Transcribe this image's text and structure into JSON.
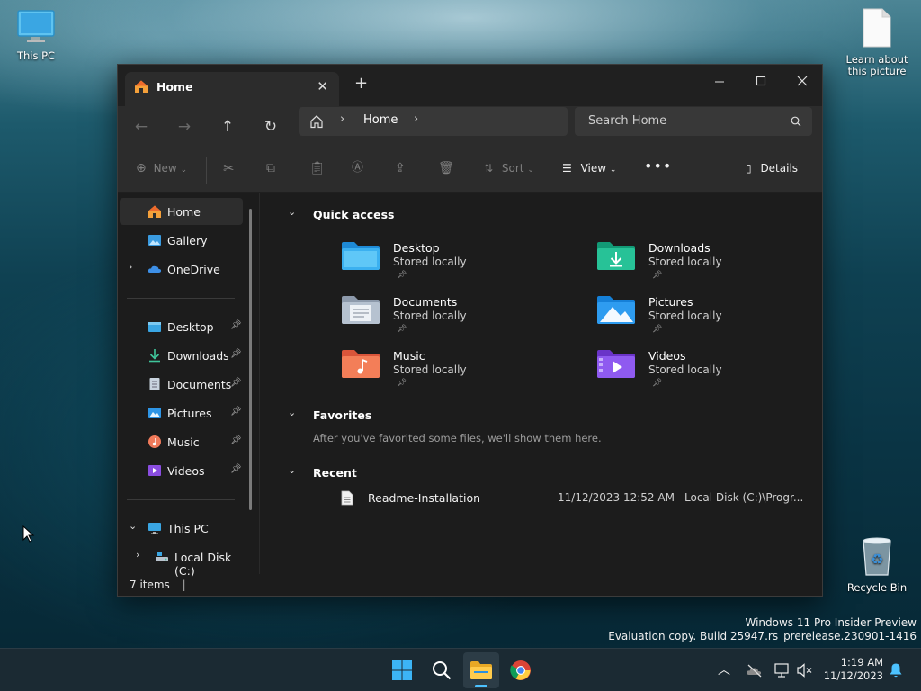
{
  "desktop": {
    "this_pc_label": "This PC",
    "learn_label": "Learn about this picture",
    "recycle_label": "Recycle Bin",
    "watermark_line1": "Windows 11 Pro Insider Preview",
    "watermark_line2": "Evaluation copy. Build 25947.rs_prerelease.230901-1416"
  },
  "window": {
    "tab_title": "Home",
    "breadcrumb": "Home",
    "search_placeholder": "Search Home",
    "toolbar": {
      "new_label": "New",
      "sort_label": "Sort",
      "view_label": "View",
      "details_label": "Details"
    },
    "sidebar": {
      "home": "Home",
      "gallery": "Gallery",
      "onedrive": "OneDrive",
      "pinned": [
        "Desktop",
        "Downloads",
        "Documents",
        "Pictures",
        "Music",
        "Videos"
      ],
      "this_pc": "This PC",
      "local_disk": "Local Disk (C:)"
    },
    "sections": {
      "quick_access": "Quick access",
      "favorites": "Favorites",
      "favorites_empty": "After you've favorited some files, we'll show them here.",
      "recent": "Recent"
    },
    "quick_access": [
      {
        "name": "Desktop",
        "status": "Stored locally"
      },
      {
        "name": "Downloads",
        "status": "Stored locally"
      },
      {
        "name": "Documents",
        "status": "Stored locally"
      },
      {
        "name": "Pictures",
        "status": "Stored locally"
      },
      {
        "name": "Music",
        "status": "Stored locally"
      },
      {
        "name": "Videos",
        "status": "Stored locally"
      }
    ],
    "recent": [
      {
        "name": "Readme-Installation",
        "date": "11/12/2023 12:52 AM",
        "location": "Local Disk (C:)\\Progr..."
      }
    ],
    "status_count": "7 items"
  },
  "taskbar": {
    "time": "1:19 AM",
    "date": "11/12/2023"
  },
  "colors": {
    "accent": "#4cc2ff",
    "window_bg": "#1c1c1c",
    "toolbar_bg": "#2c2c2c"
  }
}
